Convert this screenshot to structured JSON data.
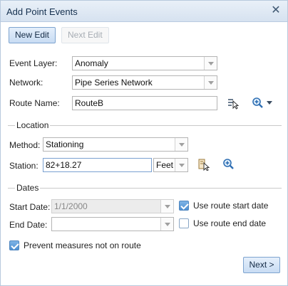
{
  "window": {
    "title": "Add Point Events"
  },
  "toolbar": {
    "new_edit": "New Edit",
    "next_edit": "Next Edit"
  },
  "form": {
    "event_layer": {
      "label": "Event Layer:",
      "value": "Anomaly"
    },
    "network": {
      "label": "Network:",
      "value": "Pipe Series Network"
    },
    "route_name": {
      "label": "Route Name:",
      "value": "RouteB"
    }
  },
  "location": {
    "section_label": "Location",
    "method": {
      "label": "Method:",
      "value": "Stationing"
    },
    "station": {
      "label": "Station:",
      "value": "82+18.27",
      "units": "Feet"
    }
  },
  "dates": {
    "section_label": "Dates",
    "start_date": {
      "label": "Start Date:",
      "value": "1/1/2000",
      "use_route_label": "Use route start date",
      "use_route_checked": true
    },
    "end_date": {
      "label": "End Date:",
      "value": "",
      "use_route_label": "Use route end date",
      "use_route_checked": false
    }
  },
  "prevent_measures": {
    "label": "Prevent measures not on route",
    "checked": true
  },
  "footer": {
    "next": "Next >"
  },
  "icons": [
    "close-icon",
    "select-route-icon",
    "zoom-route-icon",
    "dropdown-caret-icon",
    "station-picker-icon",
    "zoom-station-icon"
  ]
}
